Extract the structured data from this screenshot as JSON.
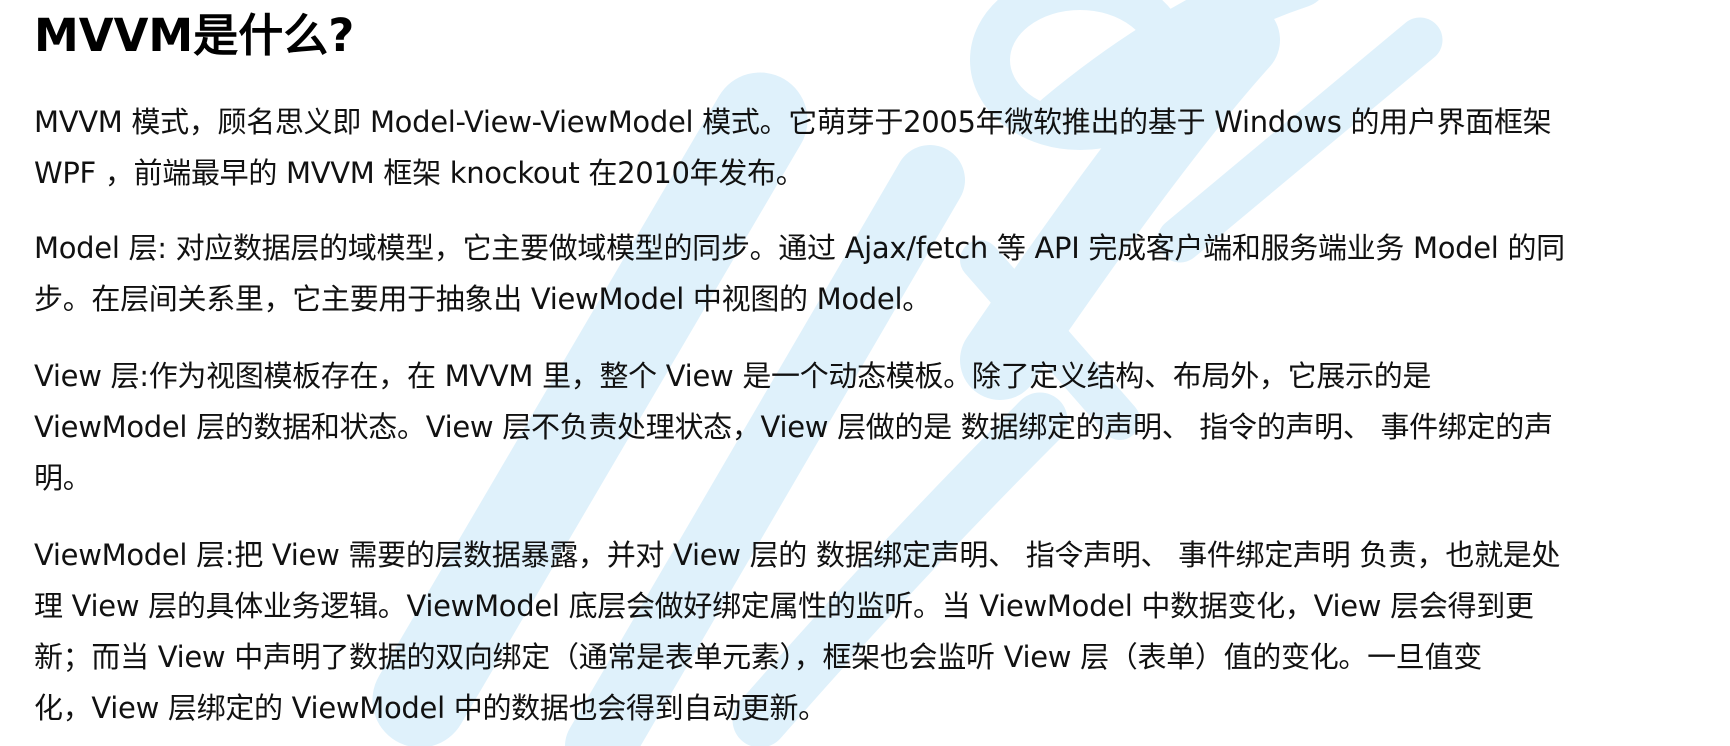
{
  "page": {
    "title": "MVVM是什么?"
  },
  "paragraphs": [
    {
      "lines": [
        "MVVM 模式，顾名思义即 Model-View-ViewModel 模式。它萌芽于2005年微软推出的基于 Windows 的用户界面框架",
        "WPF ，前端最早的 MVVM 框架 knockout 在2010年发布。"
      ]
    },
    {
      "lines": [
        "Model 层: 对应数据层的域模型，它主要做域模型的同步。通过 Ajax/fetch 等 API 完成客户端和服务端业务 Model 的同",
        "步。在层间关系里，它主要用于抽象出 ViewModel 中视图的 Model。"
      ]
    },
    {
      "lines": [
        "View 层:作为视图模板存在，在 MVVM 里，整个 View 是一个动态模板。除了定义结构、布局外，它展示的是",
        "ViewModel 层的数据和状态。View 层不负责处理状态，View 层做的是 数据绑定的声明、 指令的声明、 事件绑定的声",
        "明。"
      ]
    },
    {
      "lines": [
        "ViewModel 层:把 View 需要的层数据暴露，并对 View 层的 数据绑定声明、 指令声明、 事件绑定声明 负责，也就是处",
        "理 View 层的具体业务逻辑。ViewModel 底层会做好绑定属性的监听。当 ViewModel 中数据变化，View 层会得到更",
        "新；而当 View 中声明了数据的双向绑定（通常是表单元素），框架也会监听 View 层（表单）值的变化。一旦值变",
        "化，View 层绑定的 ViewModel 中的数据也会得到自动更新。"
      ]
    }
  ],
  "watermark": {
    "color": "#dff1fb"
  }
}
